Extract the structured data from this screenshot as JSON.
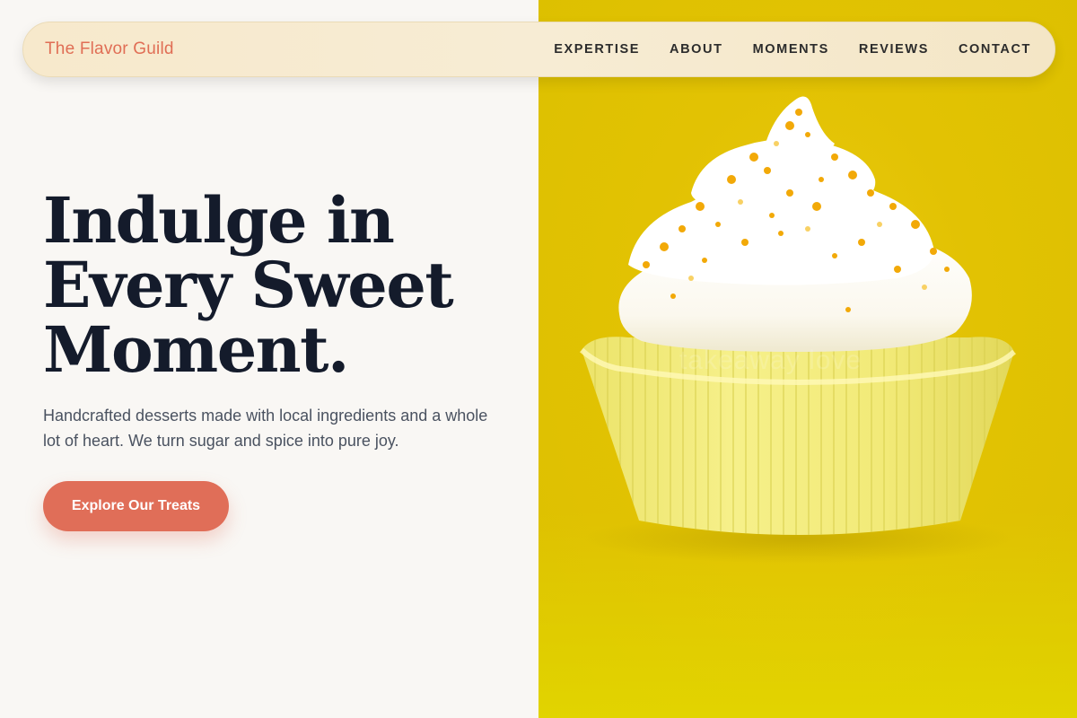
{
  "brand": "The Flavor Guild",
  "nav": {
    "items": [
      "EXPERTISE",
      "ABOUT",
      "MOMENTS",
      "REVIEWS",
      "CONTACT"
    ]
  },
  "hero": {
    "title_lines": [
      "Indulge in",
      "Every Sweet",
      "Moment."
    ],
    "description": "Handcrafted desserts made with local ingredients and a whole lot of heart. We turn sugar and spice into pure joy.",
    "cta_label": "Explore Our Treats"
  },
  "image": {
    "subject": "cupcake-photo",
    "watermark": "takeaway love"
  },
  "colors": {
    "accent": "#e06e58",
    "brand_text": "#e06e55",
    "heading": "#141b2b",
    "photo_background": "#e2c203",
    "nav_background": "#f7ebd2"
  }
}
